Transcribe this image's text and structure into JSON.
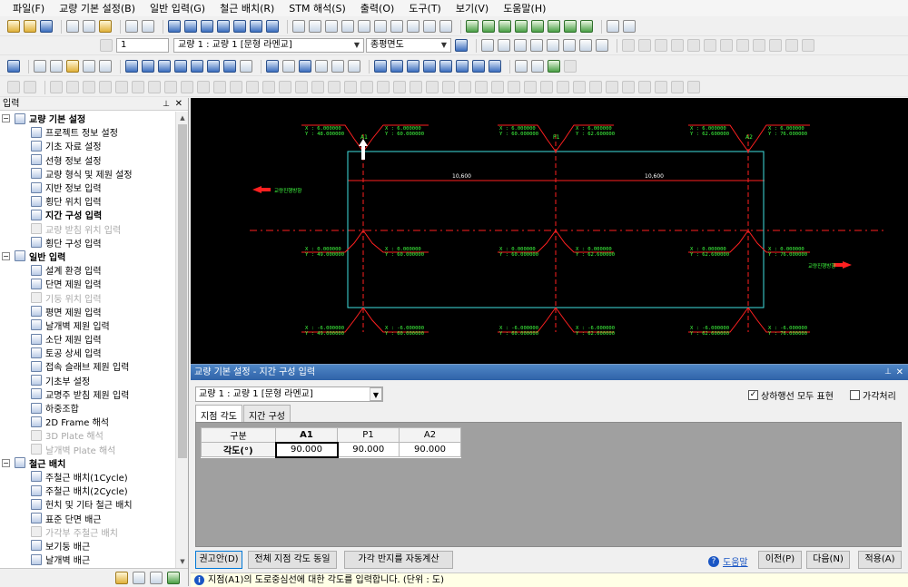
{
  "menu": [
    "파일(F)",
    "교량 기본 설정(B)",
    "일반 입력(G)",
    "철근 배치(R)",
    "STM 해석(S)",
    "출력(O)",
    "도구(T)",
    "보기(V)",
    "도움말(H)"
  ],
  "toolbar2": {
    "number_value": "1",
    "bridge_select": "교량 1 : 교량 1 [문형 라멘교]",
    "view_select": "종평면도"
  },
  "panel": {
    "title": "입력",
    "groups": [
      {
        "label": "교량 기본 설정",
        "items": [
          {
            "label": "프로젝트 정보 설정",
            "disabled": false
          },
          {
            "label": "기초 자료 설정",
            "disabled": false
          },
          {
            "label": "선형 정보 설정",
            "disabled": false
          },
          {
            "label": "교량 형식 및 제원 설정",
            "disabled": false
          },
          {
            "label": "지반 정보 입력",
            "disabled": false
          },
          {
            "label": "횡단 위치 입력",
            "disabled": false
          },
          {
            "label": "지간 구성 입력",
            "disabled": false,
            "bold": true
          },
          {
            "label": "교량 받침 위치 입력",
            "disabled": true
          },
          {
            "label": "횡단 구성 입력",
            "disabled": false
          }
        ]
      },
      {
        "label": "일반 입력",
        "items": [
          {
            "label": "설계 환경 입력",
            "disabled": false
          },
          {
            "label": "단면 제원 입력",
            "disabled": false
          },
          {
            "label": "기둥 위치 입력",
            "disabled": true
          },
          {
            "label": "평면 제원 입력",
            "disabled": false
          },
          {
            "label": "날개벽 제원 입력",
            "disabled": false
          },
          {
            "label": "소단 제원 입력",
            "disabled": false
          },
          {
            "label": "토공 상세 입력",
            "disabled": false
          },
          {
            "label": "접속 슬래브 제원 입력",
            "disabled": false
          },
          {
            "label": "기초부 설정",
            "disabled": false
          },
          {
            "label": "교명주 받침 제원 입력",
            "disabled": false
          },
          {
            "label": "하중조합",
            "disabled": false
          },
          {
            "label": "2D Frame 해석",
            "disabled": false
          },
          {
            "label": "3D Plate 해석",
            "disabled": true
          },
          {
            "label": "날개벽 Plate 해석",
            "disabled": true
          }
        ]
      },
      {
        "label": "철근 배치",
        "items": [
          {
            "label": "주철근 배치(1Cycle)",
            "disabled": false
          },
          {
            "label": "주철근 배치(2Cycle)",
            "disabled": false
          },
          {
            "label": "헌치 및 기타 철근 배치",
            "disabled": false
          },
          {
            "label": "표준 단면 배근",
            "disabled": false
          },
          {
            "label": "가각부 주철근 배치",
            "disabled": true
          },
          {
            "label": "보기둥 배근",
            "disabled": false
          },
          {
            "label": "날개벽 배근",
            "disabled": false
          }
        ]
      }
    ]
  },
  "canvas": {
    "dim_left": "10,600",
    "dim_right": "10,600",
    "coord_labels_top": [
      "X : 6.000000\nY : 48.000000",
      "X : 6.000000\nY : 60.000000",
      "X : 6.000000\nY : 62.600000",
      "X : 6.000000\nY : 76.000000"
    ],
    "coord_labels_mid": [
      "X : 0.000000\nY : 49.000000",
      "X : 0.000000\nY : 60.000000",
      "X : 0.000000\nY : 62.600000",
      "X : 0.000000\nY : 76.000000"
    ],
    "coord_labels_bot": [
      "X : -6.000000\nY : 49.000000",
      "X : -6.000000\nY : 60.000000",
      "X : -6.000000\nY : 62.600000",
      "X : -6.000000\nY : 76.000000"
    ],
    "pier_labels": [
      "A1",
      "P1",
      "A2"
    ],
    "left_arrow_label": "교량진행방향",
    "right_arrow_label": "교량진행방향"
  },
  "dialog": {
    "title": "교량 기본 설정 - 지간 구성 입력",
    "bridge_select": "교량 1 : 교량 1 [문형 라멘교]",
    "check_all_lines": "상하행선 모두 표현",
    "check_all_lines_checked": true,
    "check_skew": "가각처리",
    "check_skew_checked": false,
    "tabs": [
      "지점 각도",
      "지간 구성"
    ],
    "grid": {
      "header": [
        "구분",
        "A1",
        "P1",
        "A2"
      ],
      "row_label": "각도(°)",
      "values": [
        "90.000",
        "90.000",
        "90.000"
      ]
    },
    "buttons": {
      "recommend": "권고안(D)",
      "same_angle": "전체 지점 각도 동일",
      "auto_skew": "가각 반지를 자동계산",
      "help": "도움말",
      "prev": "이전(P)",
      "next": "다음(N)",
      "apply": "적용(A)"
    },
    "status": "지점(A1)의 도로중심선에 대한 각도를 입력합니다. (단위 : 도)"
  }
}
